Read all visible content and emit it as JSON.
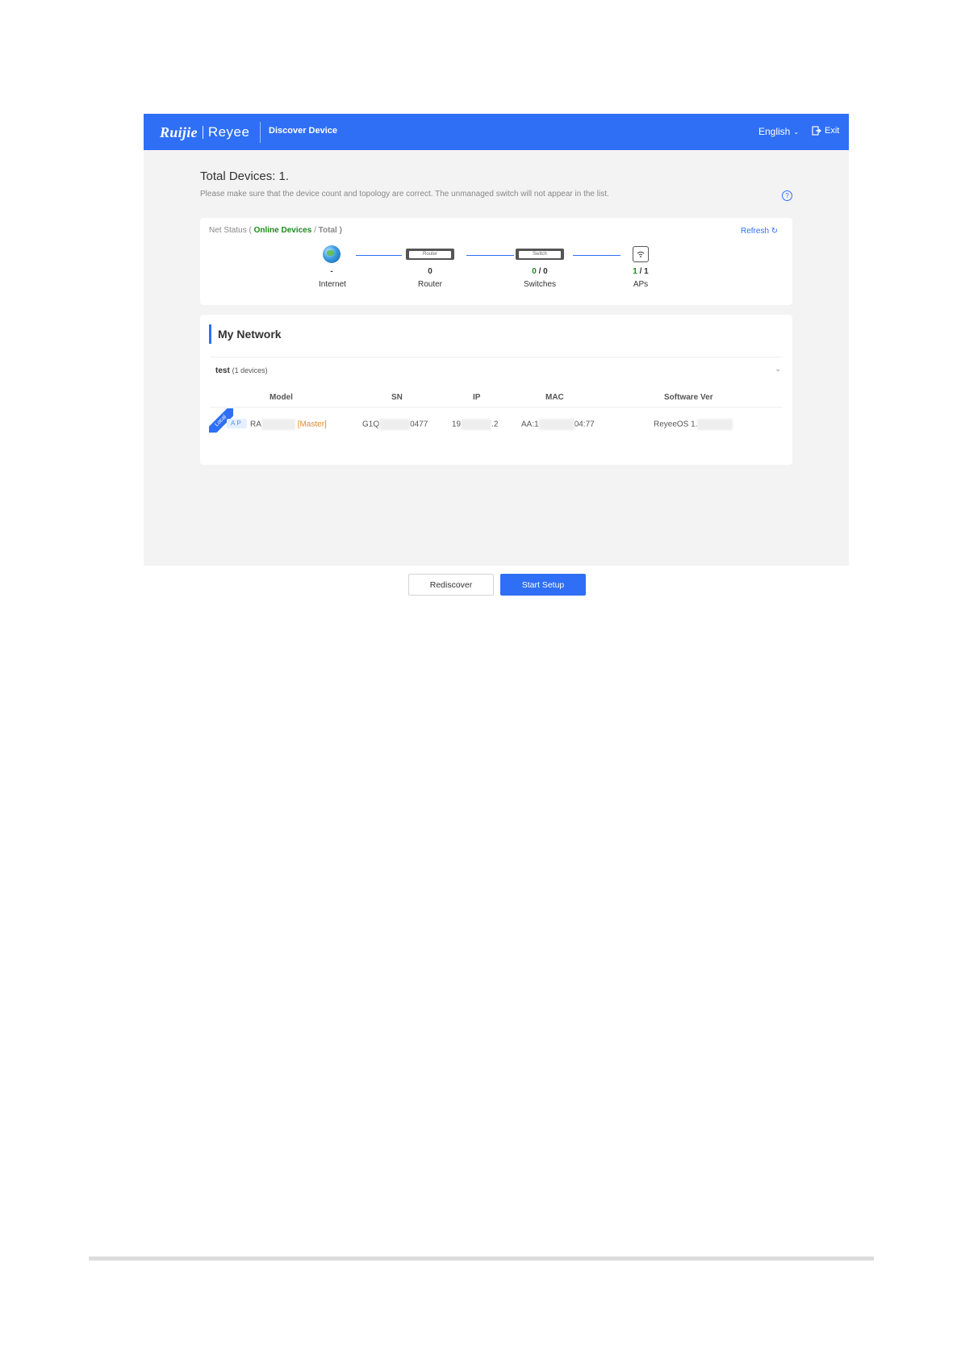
{
  "header": {
    "logo_brand": "Ruijie",
    "logo_product": "Reyee",
    "title": "Discover Device",
    "language": "English",
    "exit_label": "Exit"
  },
  "summary": {
    "total_devices": "Total Devices: 1.",
    "hint": "Please make sure that the device count and topology are correct. The unmanaged switch will not appear in the list."
  },
  "net_status": {
    "label_prefix": "Net Status (",
    "online_label": "Online Devices",
    "slash": "/",
    "total_label": "Total )",
    "refresh_label": "Refresh",
    "nodes": {
      "internet": {
        "count": "-",
        "label": "Internet"
      },
      "router": {
        "count": "0",
        "label": "Router",
        "box_text": "Router"
      },
      "switches": {
        "online": "0",
        "total": "0",
        "label": "Switches",
        "box_text": "Switch"
      },
      "aps": {
        "online": "1",
        "total": "1",
        "label": "APs"
      }
    }
  },
  "my_network": {
    "title": "My Network",
    "group": {
      "name": "test",
      "count_text": "(1 devices)"
    },
    "columns": [
      "Model",
      "SN",
      "IP",
      "MAC",
      "Software Ver"
    ],
    "row": {
      "ribbon": "Local",
      "type": "AP",
      "model_prefix": "RA",
      "role": "[Master]",
      "sn_prefix": "G1Q",
      "sn_suffix": "0477",
      "ip_prefix": "19",
      "ip_suffix": ".2",
      "mac_prefix": "AA:1",
      "mac_suffix": "04:77",
      "software_prefix": "ReyeeOS 1."
    }
  },
  "actions": {
    "rediscover": "Rediscover",
    "start_setup": "Start Setup"
  },
  "colors": {
    "brand_blue": "#2e6ff5",
    "online_green": "#1a8a1a",
    "master_orange": "#e08a2b"
  }
}
